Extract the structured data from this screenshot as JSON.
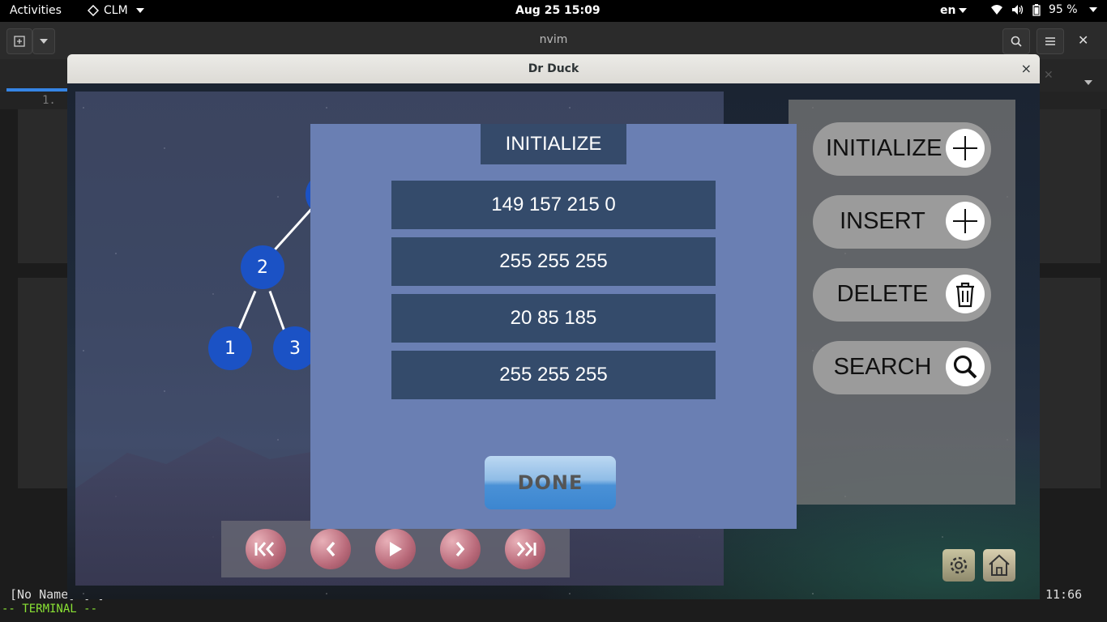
{
  "topbar": {
    "activities": "Activities",
    "app_name": "CLM",
    "clock": "Aug 25  15:09",
    "lang": "en",
    "battery": "95 %"
  },
  "terminal": {
    "title": "nvim",
    "line_number": "1.",
    "status_left": "[No Name] [+]",
    "mode": "-- TERMINAL --",
    "position": "11:66"
  },
  "window": {
    "title": "Dr Duck",
    "close": "×"
  },
  "tree": {
    "nodes": [
      "2",
      "1",
      "3"
    ]
  },
  "modal": {
    "title": "INITIALIZE",
    "rows": [
      "149 157 215 0",
      "255 255 255",
      "20 85 185",
      "255 255 255"
    ],
    "done_label": "DONE"
  },
  "actions": {
    "initialize": "INITIALIZE",
    "insert": "INSERT",
    "delete": "DELETE",
    "search": "SEARCH"
  },
  "colors": {
    "node": "#1b52c5",
    "modal_bg": "#6a7fb3",
    "modal_row": "#344b6b"
  }
}
